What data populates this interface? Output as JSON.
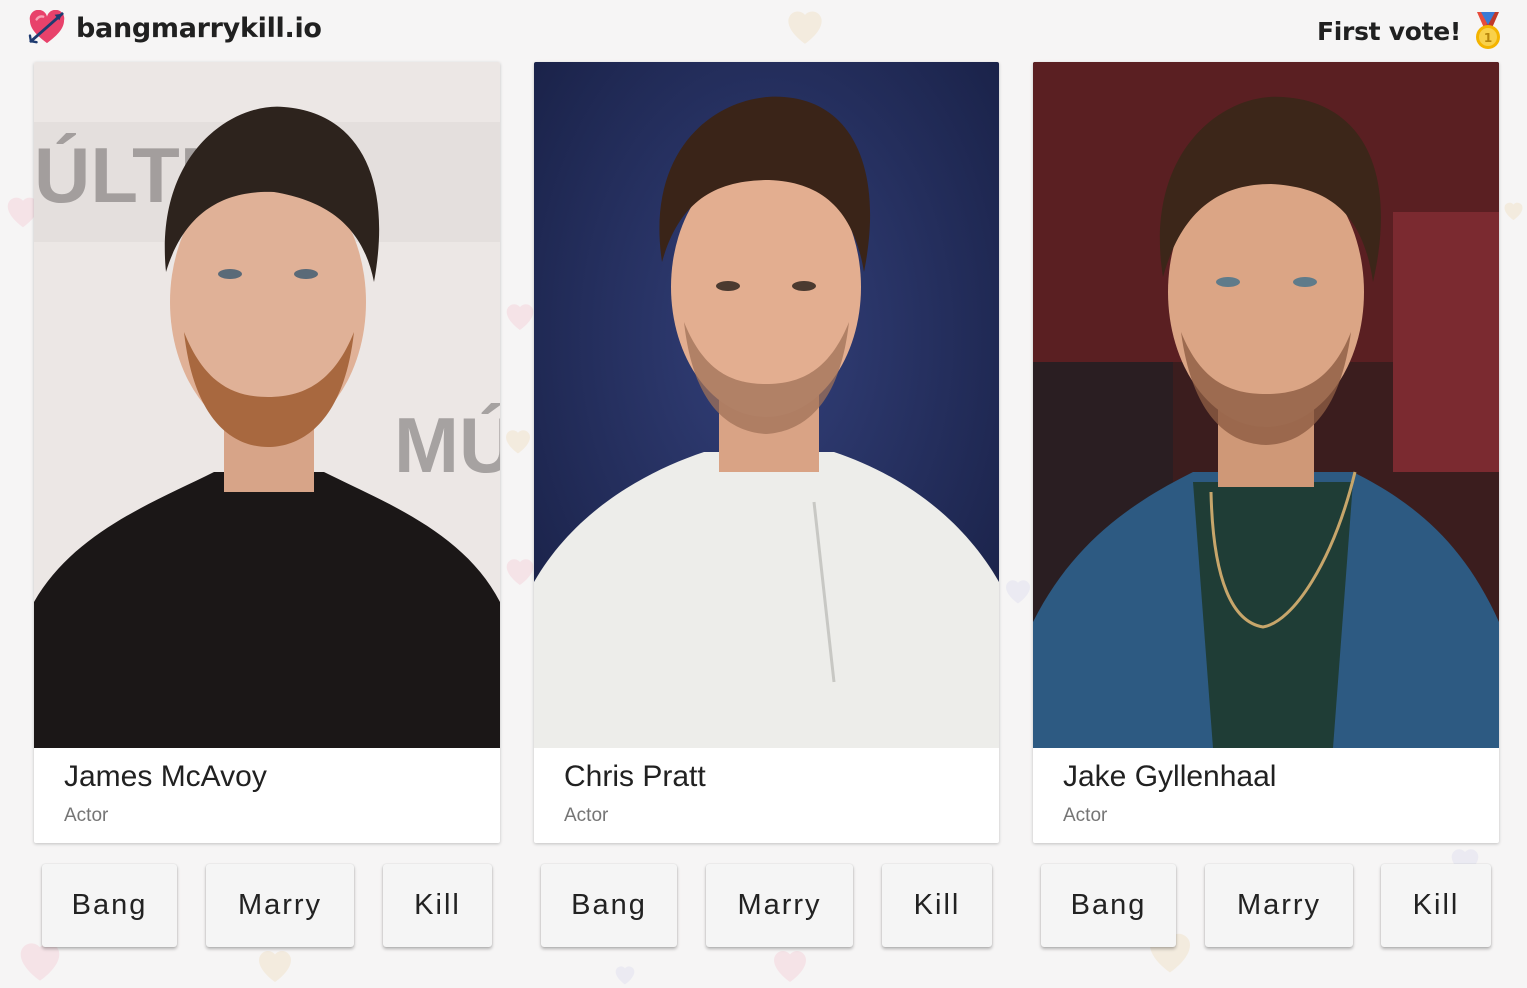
{
  "header": {
    "site_name": "bangmarrykill.io",
    "site_icon": "heart-arrow-icon",
    "vote_status": "First vote!",
    "vote_icon": "medal-icon"
  },
  "cards": [
    {
      "name": "James McAvoy",
      "role": "Actor",
      "actions": [
        "Bang",
        "Marry",
        "Kill"
      ]
    },
    {
      "name": "Chris Pratt",
      "role": "Actor",
      "actions": [
        "Bang",
        "Marry",
        "Kill"
      ]
    },
    {
      "name": "Jake Gyllenhaal",
      "role": "Actor",
      "actions": [
        "Bang",
        "Marry",
        "Kill"
      ]
    }
  ],
  "colors": {
    "background": "#f6f5f5",
    "card": "#ffffff",
    "button": "#f5f5f5",
    "heart": "#e8426b"
  }
}
